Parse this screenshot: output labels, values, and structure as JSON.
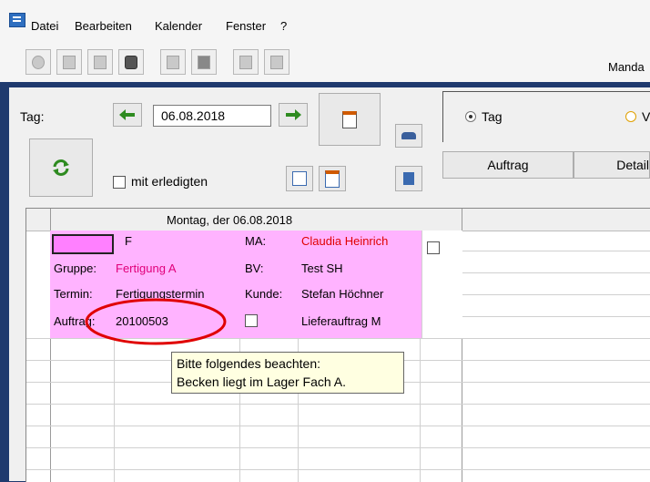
{
  "menu": {
    "items": [
      "Datei",
      "Bearbeiten",
      "Kalender",
      "Fenster",
      "?"
    ]
  },
  "toolbar": {
    "mandant_label": "Manda"
  },
  "form": {
    "tag_label": "Tag:",
    "date_value": "06.08.2018",
    "mit_erledigten_label": "mit erledigten",
    "view_radio_tag": "Tag",
    "view_radio_second_partial": "V",
    "tab_auftrag": "Auftrag",
    "tab_detail": "Detail"
  },
  "calendar": {
    "day_header": "Montag, der 06.08.2018",
    "entry": {
      "status": "F",
      "ma_label": "MA:",
      "ma_value": "Claudia Heinrich",
      "gruppe_label": "Gruppe:",
      "gruppe_value": "Fertigung A",
      "bv_label": "BV:",
      "bv_value": "Test SH",
      "termin_label": "Termin:",
      "termin_value": "Fertigungstermin",
      "kunde_label": "Kunde:",
      "kunde_value": "Stefan Höchner",
      "auftrag_label": "Auftrag:",
      "auftrag_value": "20100503",
      "auftragsart_value": "Lieferauftrag M"
    }
  },
  "tooltip": {
    "line1": "Bitte folgendes beachten:",
    "line2": "Becken liegt im Lager Fach A."
  },
  "colors": {
    "entry_bg": "#ffb3ff",
    "entry_text_pink": "#e0007a",
    "highlight_red": "#e00000",
    "tooltip_bg": "#ffffe1"
  }
}
